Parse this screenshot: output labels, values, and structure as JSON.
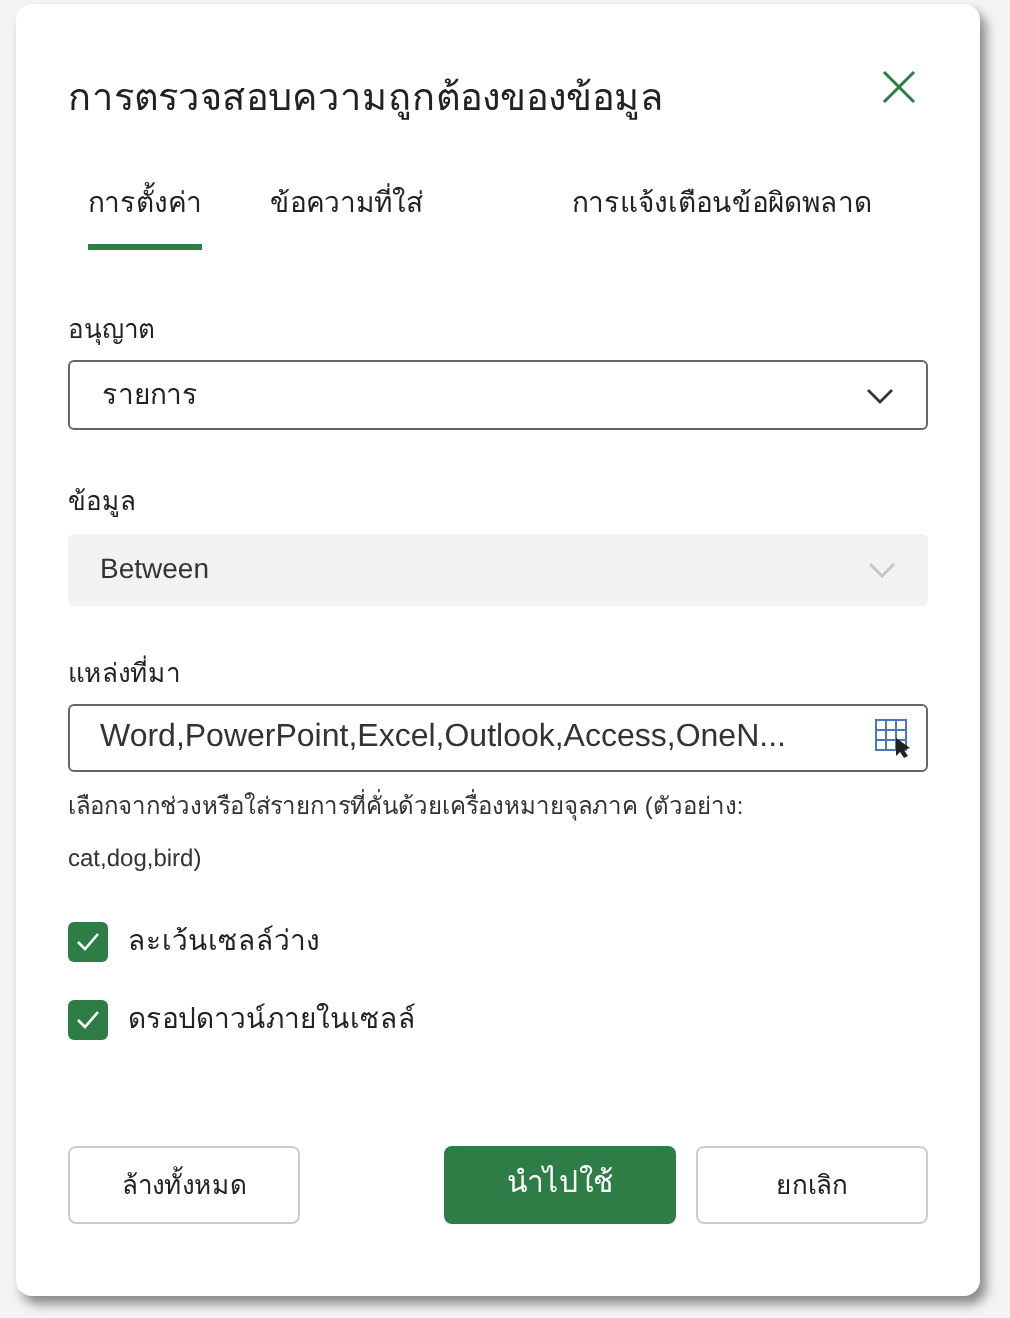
{
  "dialog": {
    "title": "การตรวจสอบความถูกต้องของข้อมูล"
  },
  "tabs": [
    {
      "label": "การตั้งค่า",
      "selected": true
    },
    {
      "label": "ข้อความที่ใส่",
      "selected": false
    },
    {
      "label": "การแจ้งเตือนข้อผิดพลาด",
      "selected": false
    }
  ],
  "allow": {
    "label": "อนุญาต",
    "value": "รายการ",
    "disabled": false
  },
  "data": {
    "label": "ข้อมูล",
    "value": "Between",
    "disabled": true
  },
  "source": {
    "label": "แหล่งที่มา",
    "value": "Word,PowerPoint,Excel,Outlook,Access,OneN...",
    "help": "เลือกจากช่วงหรือใส่รายการที่คั่นด้วยเครื่องหมายจุลภาค (ตัวอย่าง: cat,dog,bird)"
  },
  "options": [
    {
      "label": "ละเว้นเซลล์ว่าง",
      "checked": true
    },
    {
      "label": "ดรอปดาวน์ภายในเซลล์",
      "checked": true
    }
  ],
  "buttons": [
    {
      "label": "ล้างทั้งหมด",
      "kind": "secondary"
    },
    {
      "label": "นำไปใช้",
      "kind": "primary"
    },
    {
      "label": "ยกเลิก",
      "kind": "secondary"
    }
  ]
}
